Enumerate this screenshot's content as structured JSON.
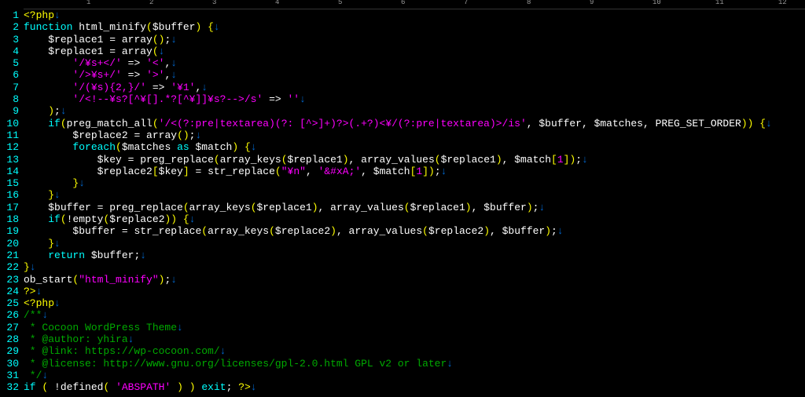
{
  "ruler": {
    "marks": [
      1,
      2,
      3,
      4,
      5,
      6,
      7,
      8,
      9,
      10,
      11,
      12
    ]
  },
  "lines": [
    {
      "n": 1,
      "tokens": [
        {
          "c": "delim",
          "t": "<?php"
        },
        {
          "c": "eol",
          "t": "↓"
        }
      ]
    },
    {
      "n": 2,
      "tokens": [
        {
          "c": "kw",
          "t": "function "
        },
        {
          "c": "func",
          "t": "html_minify"
        },
        {
          "c": "paren",
          "t": "("
        },
        {
          "c": "var",
          "t": "$buffer"
        },
        {
          "c": "paren",
          "t": ")"
        },
        {
          "c": "plain",
          "t": " "
        },
        {
          "c": "paren",
          "t": "{"
        },
        {
          "c": "eol",
          "t": "↓"
        }
      ]
    },
    {
      "n": 3,
      "tokens": [
        {
          "c": "plain",
          "t": "    "
        },
        {
          "c": "var",
          "t": "$replace1"
        },
        {
          "c": "plain",
          "t": " = "
        },
        {
          "c": "func",
          "t": "array"
        },
        {
          "c": "paren",
          "t": "()"
        },
        {
          "c": "plain",
          "t": ";"
        },
        {
          "c": "eol",
          "t": "↓"
        }
      ]
    },
    {
      "n": 4,
      "tokens": [
        {
          "c": "plain",
          "t": "    "
        },
        {
          "c": "var",
          "t": "$replace1"
        },
        {
          "c": "plain",
          "t": " = "
        },
        {
          "c": "func",
          "t": "array"
        },
        {
          "c": "paren",
          "t": "("
        },
        {
          "c": "eol",
          "t": "↓"
        }
      ]
    },
    {
      "n": 5,
      "tokens": [
        {
          "c": "plain",
          "t": "        "
        },
        {
          "c": "str",
          "t": "'/¥s+</'"
        },
        {
          "c": "plain",
          "t": " => "
        },
        {
          "c": "str",
          "t": "'<'"
        },
        {
          "c": "plain",
          "t": ","
        },
        {
          "c": "eol",
          "t": "↓"
        }
      ]
    },
    {
      "n": 6,
      "tokens": [
        {
          "c": "plain",
          "t": "        "
        },
        {
          "c": "str",
          "t": "'/>¥s+/'"
        },
        {
          "c": "plain",
          "t": " => "
        },
        {
          "c": "str",
          "t": "'>'"
        },
        {
          "c": "plain",
          "t": ","
        },
        {
          "c": "eol",
          "t": "↓"
        }
      ]
    },
    {
      "n": 7,
      "tokens": [
        {
          "c": "plain",
          "t": "        "
        },
        {
          "c": "str",
          "t": "'/(¥s){2,}/'"
        },
        {
          "c": "plain",
          "t": " => "
        },
        {
          "c": "str",
          "t": "'¥1'"
        },
        {
          "c": "plain",
          "t": ","
        },
        {
          "c": "eol",
          "t": "↓"
        }
      ]
    },
    {
      "n": 8,
      "tokens": [
        {
          "c": "plain",
          "t": "        "
        },
        {
          "c": "str",
          "t": "'/<!--¥s?[^¥[].*?[^¥]]¥s?-->/s'"
        },
        {
          "c": "plain",
          "t": " => "
        },
        {
          "c": "str",
          "t": "''"
        },
        {
          "c": "eol",
          "t": "↓"
        }
      ]
    },
    {
      "n": 9,
      "tokens": [
        {
          "c": "plain",
          "t": "    "
        },
        {
          "c": "paren",
          "t": ")"
        },
        {
          "c": "plain",
          "t": ";"
        },
        {
          "c": "eol",
          "t": "↓"
        }
      ]
    },
    {
      "n": 10,
      "tokens": [
        {
          "c": "plain",
          "t": "    "
        },
        {
          "c": "kw",
          "t": "if"
        },
        {
          "c": "paren",
          "t": "("
        },
        {
          "c": "func",
          "t": "preg_match_all"
        },
        {
          "c": "paren",
          "t": "("
        },
        {
          "c": "str",
          "t": "'/<(?:pre|textarea)(?: [^>]+)?>(.+?)<¥/(?:pre|textarea)>/is'"
        },
        {
          "c": "plain",
          "t": ", "
        },
        {
          "c": "var",
          "t": "$buffer"
        },
        {
          "c": "plain",
          "t": ", "
        },
        {
          "c": "var",
          "t": "$matches"
        },
        {
          "c": "plain",
          "t": ", "
        },
        {
          "c": "const",
          "t": "PREG_SET_ORDER"
        },
        {
          "c": "paren",
          "t": "))"
        },
        {
          "c": "plain",
          "t": " "
        },
        {
          "c": "paren",
          "t": "{"
        },
        {
          "c": "eol",
          "t": "↓"
        }
      ]
    },
    {
      "n": 11,
      "tokens": [
        {
          "c": "plain",
          "t": "        "
        },
        {
          "c": "var",
          "t": "$replace2"
        },
        {
          "c": "plain",
          "t": " = "
        },
        {
          "c": "func",
          "t": "array"
        },
        {
          "c": "paren",
          "t": "()"
        },
        {
          "c": "plain",
          "t": ";"
        },
        {
          "c": "eol",
          "t": "↓"
        }
      ]
    },
    {
      "n": 12,
      "tokens": [
        {
          "c": "plain",
          "t": "        "
        },
        {
          "c": "kw",
          "t": "foreach"
        },
        {
          "c": "paren",
          "t": "("
        },
        {
          "c": "var",
          "t": "$matches"
        },
        {
          "c": "plain",
          "t": " "
        },
        {
          "c": "kw",
          "t": "as"
        },
        {
          "c": "plain",
          "t": " "
        },
        {
          "c": "var",
          "t": "$match"
        },
        {
          "c": "paren",
          "t": ")"
        },
        {
          "c": "plain",
          "t": " "
        },
        {
          "c": "paren",
          "t": "{"
        },
        {
          "c": "eol",
          "t": "↓"
        }
      ]
    },
    {
      "n": 13,
      "tokens": [
        {
          "c": "plain",
          "t": "            "
        },
        {
          "c": "var",
          "t": "$key"
        },
        {
          "c": "plain",
          "t": " = "
        },
        {
          "c": "func",
          "t": "preg_replace"
        },
        {
          "c": "paren",
          "t": "("
        },
        {
          "c": "func",
          "t": "array_keys"
        },
        {
          "c": "paren",
          "t": "("
        },
        {
          "c": "var",
          "t": "$replace1"
        },
        {
          "c": "paren",
          "t": ")"
        },
        {
          "c": "plain",
          "t": ", "
        },
        {
          "c": "func",
          "t": "array_values"
        },
        {
          "c": "paren",
          "t": "("
        },
        {
          "c": "var",
          "t": "$replace1"
        },
        {
          "c": "paren",
          "t": ")"
        },
        {
          "c": "plain",
          "t": ", "
        },
        {
          "c": "var",
          "t": "$match"
        },
        {
          "c": "paren",
          "t": "["
        },
        {
          "c": "num",
          "t": "1"
        },
        {
          "c": "paren",
          "t": "])"
        },
        {
          "c": "plain",
          "t": ";"
        },
        {
          "c": "eol",
          "t": "↓"
        }
      ]
    },
    {
      "n": 14,
      "tokens": [
        {
          "c": "plain",
          "t": "            "
        },
        {
          "c": "var",
          "t": "$replace2"
        },
        {
          "c": "paren",
          "t": "["
        },
        {
          "c": "var",
          "t": "$key"
        },
        {
          "c": "paren",
          "t": "]"
        },
        {
          "c": "plain",
          "t": " = "
        },
        {
          "c": "func",
          "t": "str_replace"
        },
        {
          "c": "paren",
          "t": "("
        },
        {
          "c": "str",
          "t": "\"¥n\""
        },
        {
          "c": "plain",
          "t": ", "
        },
        {
          "c": "str",
          "t": "'&#xA;'"
        },
        {
          "c": "plain",
          "t": ", "
        },
        {
          "c": "var",
          "t": "$match"
        },
        {
          "c": "paren",
          "t": "["
        },
        {
          "c": "num",
          "t": "1"
        },
        {
          "c": "paren",
          "t": "])"
        },
        {
          "c": "plain",
          "t": ";"
        },
        {
          "c": "eol",
          "t": "↓"
        }
      ]
    },
    {
      "n": 15,
      "tokens": [
        {
          "c": "plain",
          "t": "        "
        },
        {
          "c": "paren",
          "t": "}"
        },
        {
          "c": "eol",
          "t": "↓"
        }
      ]
    },
    {
      "n": 16,
      "tokens": [
        {
          "c": "plain",
          "t": "    "
        },
        {
          "c": "paren",
          "t": "}"
        },
        {
          "c": "eol",
          "t": "↓"
        }
      ]
    },
    {
      "n": 17,
      "tokens": [
        {
          "c": "plain",
          "t": "    "
        },
        {
          "c": "var",
          "t": "$buffer"
        },
        {
          "c": "plain",
          "t": " = "
        },
        {
          "c": "func",
          "t": "preg_replace"
        },
        {
          "c": "paren",
          "t": "("
        },
        {
          "c": "func",
          "t": "array_keys"
        },
        {
          "c": "paren",
          "t": "("
        },
        {
          "c": "var",
          "t": "$replace1"
        },
        {
          "c": "paren",
          "t": ")"
        },
        {
          "c": "plain",
          "t": ", "
        },
        {
          "c": "func",
          "t": "array_values"
        },
        {
          "c": "paren",
          "t": "("
        },
        {
          "c": "var",
          "t": "$replace1"
        },
        {
          "c": "paren",
          "t": ")"
        },
        {
          "c": "plain",
          "t": ", "
        },
        {
          "c": "var",
          "t": "$buffer"
        },
        {
          "c": "paren",
          "t": ")"
        },
        {
          "c": "plain",
          "t": ";"
        },
        {
          "c": "eol",
          "t": "↓"
        }
      ]
    },
    {
      "n": 18,
      "tokens": [
        {
          "c": "plain",
          "t": "    "
        },
        {
          "c": "kw",
          "t": "if"
        },
        {
          "c": "paren",
          "t": "("
        },
        {
          "c": "plain",
          "t": "!"
        },
        {
          "c": "func",
          "t": "empty"
        },
        {
          "c": "paren",
          "t": "("
        },
        {
          "c": "var",
          "t": "$replace2"
        },
        {
          "c": "paren",
          "t": "))"
        },
        {
          "c": "plain",
          "t": " "
        },
        {
          "c": "paren",
          "t": "{"
        },
        {
          "c": "eol",
          "t": "↓"
        }
      ]
    },
    {
      "n": 19,
      "tokens": [
        {
          "c": "plain",
          "t": "        "
        },
        {
          "c": "var",
          "t": "$buffer"
        },
        {
          "c": "plain",
          "t": " = "
        },
        {
          "c": "func",
          "t": "str_replace"
        },
        {
          "c": "paren",
          "t": "("
        },
        {
          "c": "func",
          "t": "array_keys"
        },
        {
          "c": "paren",
          "t": "("
        },
        {
          "c": "var",
          "t": "$replace2"
        },
        {
          "c": "paren",
          "t": ")"
        },
        {
          "c": "plain",
          "t": ", "
        },
        {
          "c": "func",
          "t": "array_values"
        },
        {
          "c": "paren",
          "t": "("
        },
        {
          "c": "var",
          "t": "$replace2"
        },
        {
          "c": "paren",
          "t": ")"
        },
        {
          "c": "plain",
          "t": ", "
        },
        {
          "c": "var",
          "t": "$buffer"
        },
        {
          "c": "paren",
          "t": ")"
        },
        {
          "c": "plain",
          "t": ";"
        },
        {
          "c": "eol",
          "t": "↓"
        }
      ]
    },
    {
      "n": 20,
      "tokens": [
        {
          "c": "plain",
          "t": "    "
        },
        {
          "c": "paren",
          "t": "}"
        },
        {
          "c": "eol",
          "t": "↓"
        }
      ]
    },
    {
      "n": 21,
      "tokens": [
        {
          "c": "plain",
          "t": "    "
        },
        {
          "c": "kw",
          "t": "return"
        },
        {
          "c": "plain",
          "t": " "
        },
        {
          "c": "var",
          "t": "$buffer"
        },
        {
          "c": "plain",
          "t": ";"
        },
        {
          "c": "eol",
          "t": "↓"
        }
      ]
    },
    {
      "n": 22,
      "tokens": [
        {
          "c": "paren",
          "t": "}"
        },
        {
          "c": "eol",
          "t": "↓"
        }
      ]
    },
    {
      "n": 23,
      "tokens": [
        {
          "c": "func",
          "t": "ob_start"
        },
        {
          "c": "paren",
          "t": "("
        },
        {
          "c": "str",
          "t": "\"html_minify\""
        },
        {
          "c": "paren",
          "t": ")"
        },
        {
          "c": "plain",
          "t": ";"
        },
        {
          "c": "eol",
          "t": "↓"
        }
      ]
    },
    {
      "n": 24,
      "tokens": [
        {
          "c": "delim",
          "t": "?>"
        },
        {
          "c": "eol",
          "t": "↓"
        }
      ]
    },
    {
      "n": 25,
      "tokens": [
        {
          "c": "delim",
          "t": "<?php"
        },
        {
          "c": "eol",
          "t": "↓"
        }
      ]
    },
    {
      "n": 26,
      "tokens": [
        {
          "c": "cmt",
          "t": "/**"
        },
        {
          "c": "eol",
          "t": "↓"
        }
      ]
    },
    {
      "n": 27,
      "tokens": [
        {
          "c": "cmt",
          "t": " * Cocoon WordPress Theme"
        },
        {
          "c": "eol",
          "t": "↓"
        }
      ]
    },
    {
      "n": 28,
      "tokens": [
        {
          "c": "cmt",
          "t": " * @author: yhira"
        },
        {
          "c": "eol",
          "t": "↓"
        }
      ]
    },
    {
      "n": 29,
      "tokens": [
        {
          "c": "cmt",
          "t": " * @link: https://wp-cocoon.com/"
        },
        {
          "c": "eol",
          "t": "↓"
        }
      ]
    },
    {
      "n": 30,
      "tokens": [
        {
          "c": "cmt",
          "t": " * @license: http://www.gnu.org/licenses/gpl-2.0.html GPL v2 or later"
        },
        {
          "c": "eol",
          "t": "↓"
        }
      ]
    },
    {
      "n": 31,
      "tokens": [
        {
          "c": "cmt",
          "t": " */"
        },
        {
          "c": "eol",
          "t": "↓"
        }
      ]
    },
    {
      "n": 32,
      "tokens": [
        {
          "c": "kw",
          "t": "if"
        },
        {
          "c": "plain",
          "t": " "
        },
        {
          "c": "paren",
          "t": "("
        },
        {
          "c": "plain",
          "t": " !"
        },
        {
          "c": "func",
          "t": "defined"
        },
        {
          "c": "paren",
          "t": "("
        },
        {
          "c": "plain",
          "t": " "
        },
        {
          "c": "str",
          "t": "'ABSPATH'"
        },
        {
          "c": "plain",
          "t": " "
        },
        {
          "c": "paren",
          "t": ")"
        },
        {
          "c": "plain",
          "t": " "
        },
        {
          "c": "paren",
          "t": ")"
        },
        {
          "c": "plain",
          "t": " "
        },
        {
          "c": "kw",
          "t": "exit"
        },
        {
          "c": "plain",
          "t": "; "
        },
        {
          "c": "delim",
          "t": "?>"
        },
        {
          "c": "eol",
          "t": "↓"
        }
      ]
    }
  ]
}
